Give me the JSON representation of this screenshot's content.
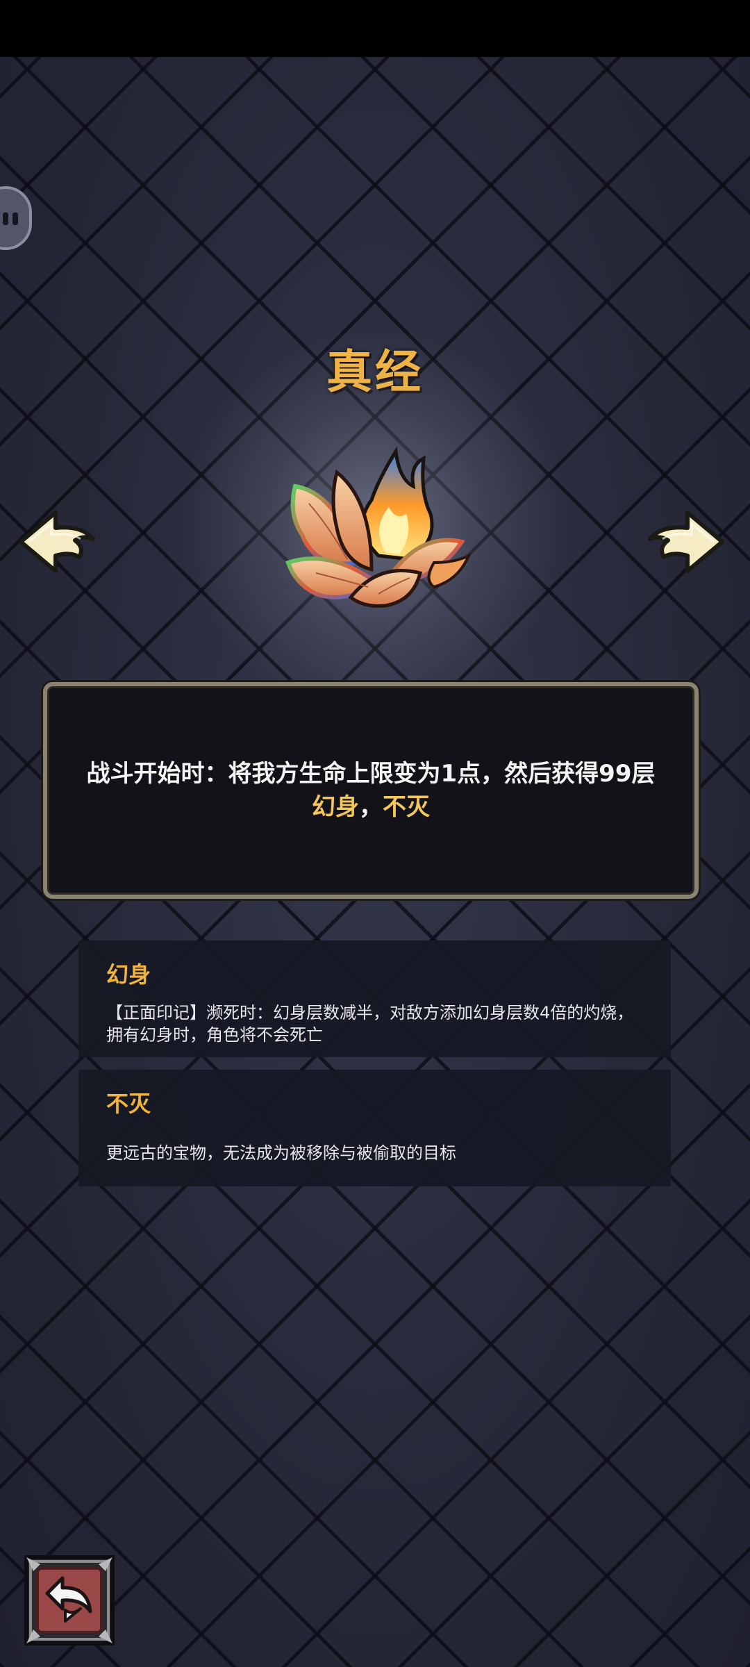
{
  "relic": {
    "name": "真经",
    "description_parts": [
      {
        "text": "战斗开始时：将我方生命上限变为1点，然后获得99层",
        "highlight": false
      },
      {
        "text": "幻身",
        "highlight": true
      },
      {
        "text": "，",
        "highlight": false
      },
      {
        "text": "不灭",
        "highlight": true
      }
    ]
  },
  "keywords": [
    {
      "title": "幻身",
      "body": "【正面印记】濒死时：幻身层数减半，对敌方添加幻身层数4倍的灼烧，拥有幻身时，角色将不会死亡"
    },
    {
      "title": "不灭",
      "body": "更远古的宝物，无法成为被移除与被偷取的目标"
    }
  ],
  "colors": {
    "title": "#f3b43c",
    "keyword_highlight": "#f3c75a",
    "box_border": "#8a8470",
    "background": "#252739"
  },
  "icons": {
    "prev": "arrow-left-icon",
    "next": "arrow-right-icon",
    "back": "back-return-icon",
    "relic": "lotus-flame-icon",
    "side_tab": "pause-tab-icon"
  }
}
